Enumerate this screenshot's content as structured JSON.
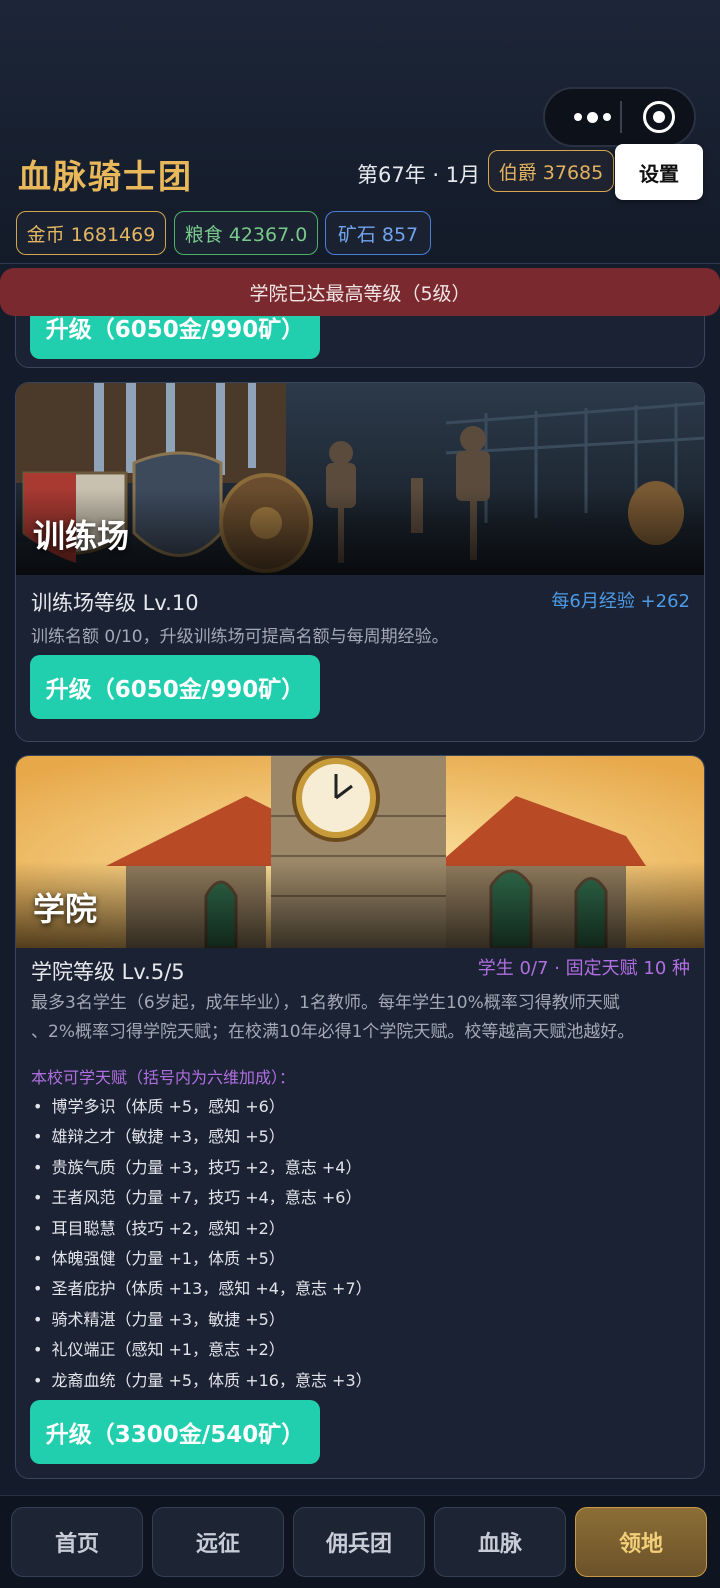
{
  "header": {
    "app_title": "血脉骑士团",
    "date": "第67年 · 1月",
    "rank": "伯爵 37685",
    "settings_label": "设置"
  },
  "resources": {
    "gold": "金币 1681469",
    "food": "粮食 42367.0",
    "ore": "矿石 857"
  },
  "toast": "学院已达最高等级（5级）",
  "cards": [
    {
      "upgrade_label": "升级（6050金/990矿）"
    },
    {
      "name": "训练场",
      "level": "训练场等级 Lv.10",
      "info": "每6月经验 +262",
      "desc": "训练名额 0/10，升级训练场可提高名额与每周期经验。",
      "upgrade_label": "升级（6050金/990矿）"
    },
    {
      "name": "学院",
      "level": "学院等级 Lv.5/5",
      "info": "学生 0/7 · 固定天赋 10 种",
      "desc_line1": "最多3名学生（6岁起，成年毕业），1名教师。每年学生10%概率习得教师天赋",
      "desc_line2": "、2%概率习得学院天赋；在校满10年必得1个学院天赋。校等越高天赋池越好。",
      "talent_header": "本校可学天赋（括号内为六维加成）：",
      "talents": [
        "博学多识（体质 +5，感知 +6）",
        "雄辩之才（敏捷 +3，感知 +5）",
        "贵族气质（力量 +3，技巧 +2，意志 +4）",
        "王者风范（力量 +7，技巧 +4，意志 +6）",
        "耳目聪慧（技巧 +2，感知 +2）",
        "体魄强健（力量 +1，体质 +5）",
        "圣者庇护（体质 +13，感知 +4，意志 +7）",
        "骑术精湛（力量 +3，敏捷 +5）",
        "礼仪端正（感知 +1，意志 +2）",
        "龙裔血统（力量 +5，体质 +16，意志 +3）"
      ],
      "upgrade_label": "升级（3300金/540矿）"
    }
  ],
  "tabs": [
    "首页",
    "远征",
    "佣兵团",
    "血脉",
    "领地"
  ],
  "active_tab": "领地",
  "colors": {
    "accent_gold": "#e8b85a",
    "upgrade_button": "#21cfae",
    "toast_bg": "#7a2a2f",
    "info_blue": "#4d9be6",
    "info_purple": "#b06fe0"
  }
}
